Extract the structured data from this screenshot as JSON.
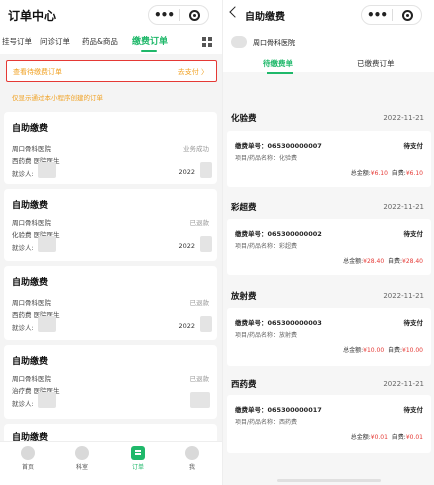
{
  "left": {
    "title": "订单中心",
    "tabs": [
      "挂号订单",
      "问诊订单",
      "药品&商品",
      "缴费订单"
    ],
    "active_tab": "缴费订单",
    "pending": {
      "label": "查看待缴费订单",
      "action": "去支付 〉"
    },
    "hint": "仅显示通过本小程序创建的订单",
    "cards": [
      {
        "title": "自助缴费",
        "hospital": "周口骨科医院",
        "dept": "西药费 医院医生",
        "patient_label": "就诊人:",
        "status": "业务成功",
        "date": "2022"
      },
      {
        "title": "自助缴费",
        "hospital": "周口骨科医院",
        "dept": "化验费 医院医生",
        "patient_label": "就诊人:",
        "status": "已退款",
        "date": "2022"
      },
      {
        "title": "自助缴费",
        "hospital": "周口骨科医院",
        "dept": "西药费 医院医生",
        "patient_label": "就诊人:",
        "status": "已退款",
        "date": "2022"
      },
      {
        "title": "自助缴费",
        "hospital": "周口骨科医院",
        "dept": "治疗费 医院医生",
        "patient_label": "就诊人:",
        "status": "已退款",
        "date": "2022"
      },
      {
        "title": "自助缴费"
      }
    ],
    "bottom_nav": [
      {
        "label": "首页",
        "icon": "home-icon"
      },
      {
        "label": "科室",
        "icon": "department-icon"
      },
      {
        "label": "订单",
        "icon": "order-icon",
        "active": true
      },
      {
        "label": "我",
        "icon": "profile-icon"
      }
    ]
  },
  "right": {
    "title": "自助缴费",
    "hospital": "周口骨科医院",
    "tabs": [
      "待缴费单",
      "已缴费订单"
    ],
    "active_tab": "待缴费单",
    "sections": [
      {
        "title": "化验费",
        "date": "2022-11-21",
        "no_label": "缴费单号：",
        "no": "065300000007",
        "status": "待支付",
        "item_label": "项目/药品名称：",
        "item": "化验费",
        "total_label": "总金额:",
        "total": "¥6.10",
        "self_label": "自费:",
        "self": "¥6.10"
      },
      {
        "title": "彩超费",
        "date": "2022-11-21",
        "no_label": "缴费单号：",
        "no": "065300000002",
        "status": "待支付",
        "item_label": "项目/药品名称：",
        "item": "彩超费",
        "total_label": "总金额:",
        "total": "¥28.40",
        "self_label": "自费:",
        "self": "¥28.40"
      },
      {
        "title": "放射费",
        "date": "2022-11-21",
        "no_label": "缴费单号：",
        "no": "065300000003",
        "status": "待支付",
        "item_label": "项目/药品名称：",
        "item": "放射费",
        "total_label": "总金额:",
        "total": "¥10.00",
        "self_label": "自费:",
        "self": "¥10.00"
      },
      {
        "title": "西药费",
        "date": "2022-11-21",
        "no_label": "缴费单号：",
        "no": "065300000017",
        "status": "待支付",
        "item_label": "项目/药品名称：",
        "item": "西药费",
        "total_label": "总金额:",
        "total": "¥0.01",
        "self_label": "自费:",
        "self": "¥0.01"
      }
    ]
  },
  "colors": {
    "accent": "#1fb86a",
    "warning": "#f0a020",
    "alert": "#e53935"
  }
}
